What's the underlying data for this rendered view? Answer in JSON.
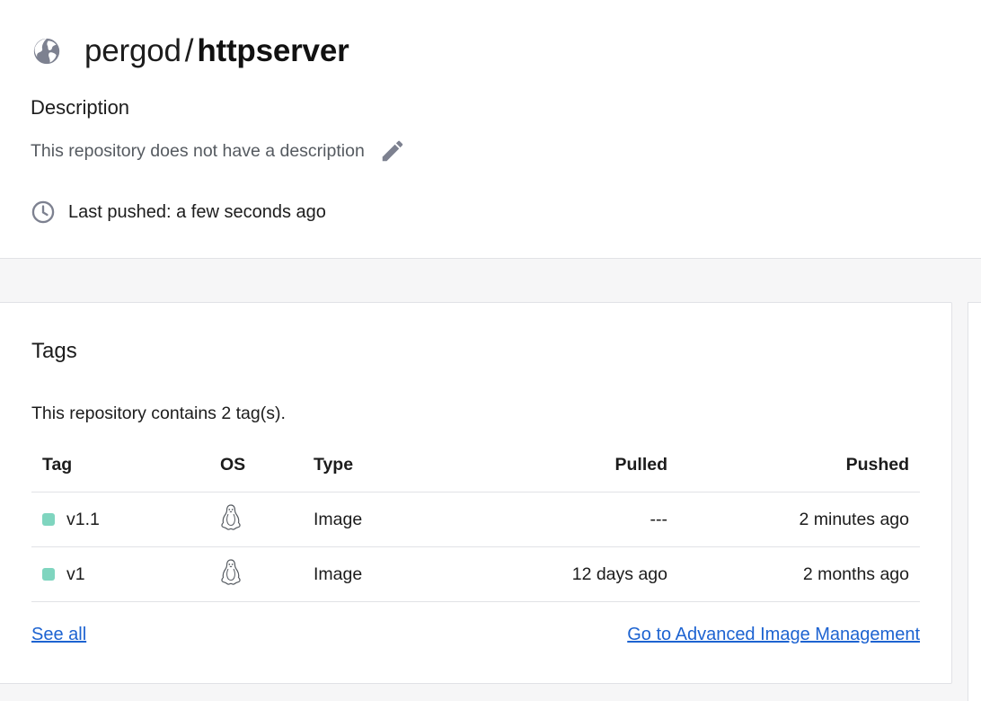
{
  "header": {
    "namespace": "pergod",
    "separator": "/",
    "repository": "httpserver",
    "globe_icon": "globe-icon",
    "description_heading": "Description",
    "description_text": "This repository does not have a description",
    "edit_icon": "pencil-icon",
    "clock_icon": "clock-icon",
    "last_pushed": "Last pushed: a few seconds ago"
  },
  "tags": {
    "heading": "Tags",
    "summary": "This repository contains 2 tag(s).",
    "columns": {
      "tag": "Tag",
      "os": "OS",
      "type": "Type",
      "pulled": "Pulled",
      "pushed": "Pushed"
    },
    "rows": [
      {
        "tag": "v1.1",
        "os_icon": "linux-icon",
        "type": "Image",
        "pulled": "---",
        "pushed": "2 minutes ago"
      },
      {
        "tag": "v1",
        "os_icon": "linux-icon",
        "type": "Image",
        "pulled": "12 days ago",
        "pushed": "2 months ago"
      }
    ],
    "see_all": "See all",
    "advanced_link": "Go to Advanced Image Management"
  },
  "colors": {
    "link": "#1d63d1",
    "tag_dot": "#7fd5bf",
    "icon_gray": "#7d8190",
    "background_gray": "#f6f6f7"
  }
}
